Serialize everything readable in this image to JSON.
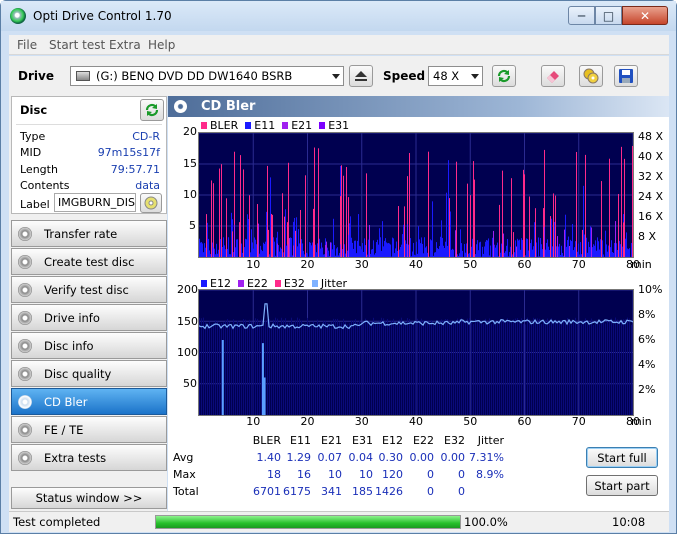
{
  "window": {
    "title": "Opti Drive Control 1.70",
    "minimize": "─",
    "maximize": "□",
    "close": "✕"
  },
  "menu": [
    "File",
    "Start test",
    "Extra",
    "Help"
  ],
  "toolbar": {
    "drive_label": "Drive",
    "drive_value": "(G:)  BENQ DVD DD DW1640 BSRB",
    "speed_label": "Speed",
    "speed_value": "48 X"
  },
  "disc": {
    "header": "Disc",
    "rows": [
      {
        "key": "Type",
        "value": "CD-R"
      },
      {
        "key": "MID",
        "value": "97m15s17f"
      },
      {
        "key": "Length",
        "value": "79:57.71"
      },
      {
        "key": "Contents",
        "value": "data"
      }
    ],
    "label_key": "Label",
    "label_value": "IMGBURN_DIS"
  },
  "nav": [
    "Transfer rate",
    "Create test disc",
    "Verify test disc",
    "Drive info",
    "Disc info",
    "Disc quality",
    "CD Bler",
    "FE / TE",
    "Extra tests"
  ],
  "nav_active_index": 6,
  "status_window_button": "Status window >>",
  "panel_title": "CD Bler",
  "chart1": {
    "legend": [
      {
        "name": "BLER",
        "color": "#ff2a8a"
      },
      {
        "name": "E11",
        "color": "#1a1aff"
      },
      {
        "name": "E21",
        "color": "#a020f0"
      },
      {
        "name": "E31",
        "color": "#7a00ff"
      }
    ],
    "yticks": [
      "20",
      "15",
      "10",
      "5"
    ],
    "y2ticks": [
      "48 X",
      "40 X",
      "32 X",
      "24 X",
      "16 X",
      "8 X"
    ],
    "xticks": [
      "10",
      "20",
      "30",
      "40",
      "50",
      "60",
      "70",
      "80"
    ],
    "xunit": "min"
  },
  "chart2": {
    "legend": [
      {
        "name": "E12",
        "color": "#1a1aff"
      },
      {
        "name": "E22",
        "color": "#a020f0"
      },
      {
        "name": "E32",
        "color": "#ff2a8a"
      },
      {
        "name": "Jitter",
        "color": "#7fb2ff"
      }
    ],
    "yticks": [
      "200",
      "150",
      "100",
      "50"
    ],
    "y2ticks": [
      "10%",
      "8%",
      "6%",
      "4%",
      "2%"
    ],
    "xticks": [
      "10",
      "20",
      "30",
      "40",
      "50",
      "60",
      "70",
      "80"
    ],
    "xunit": "min"
  },
  "chart_data": [
    {
      "type": "bar",
      "title": "",
      "x_range": [
        0,
        80
      ],
      "ylim": [
        0,
        20
      ],
      "y2lim_speed_x": [
        0,
        48
      ],
      "x_unit": "min",
      "series": [
        {
          "name": "BLER",
          "avg": 1.4,
          "max": 18,
          "total": 6701
        },
        {
          "name": "E11",
          "avg": 1.29,
          "max": 16,
          "total": 6175
        },
        {
          "name": "E21",
          "avg": 0.07,
          "max": 10,
          "total": 341
        },
        {
          "name": "E31",
          "avg": 0.04,
          "max": 10,
          "total": 185
        }
      ]
    },
    {
      "type": "line",
      "title": "",
      "x_range": [
        0,
        80
      ],
      "ylim": [
        0,
        200
      ],
      "y2lim_percent": [
        0,
        10
      ],
      "x_unit": "min",
      "series": [
        {
          "name": "E12",
          "avg": 0.3,
          "max": 120,
          "total": 1426
        },
        {
          "name": "E22",
          "avg": 0.0,
          "max": 0,
          "total": 0
        },
        {
          "name": "E32",
          "avg": 0.0,
          "max": 0,
          "total": 0
        },
        {
          "name": "Jitter",
          "avg": 7.31,
          "max": 8.9,
          "unit": "%"
        }
      ]
    }
  ],
  "stats": {
    "headers": [
      "BLER",
      "E11",
      "E21",
      "E31",
      "E12",
      "E22",
      "E32",
      "Jitter"
    ],
    "rows": [
      {
        "label": "Avg",
        "values": [
          "1.40",
          "1.29",
          "0.07",
          "0.04",
          "0.30",
          "0.00",
          "0.00",
          "7.31%"
        ]
      },
      {
        "label": "Max",
        "values": [
          "18",
          "16",
          "10",
          "10",
          "120",
          "0",
          "0",
          "8.9%"
        ]
      },
      {
        "label": "Total",
        "values": [
          "6701",
          "6175",
          "341",
          "185",
          "1426",
          "0",
          "0",
          ""
        ]
      }
    ]
  },
  "buttons": {
    "start_full": "Start full",
    "start_part": "Start part"
  },
  "status": {
    "text": "Test completed",
    "progress_label": "100.0%",
    "progress_value": 1.0,
    "time": "10:08"
  }
}
